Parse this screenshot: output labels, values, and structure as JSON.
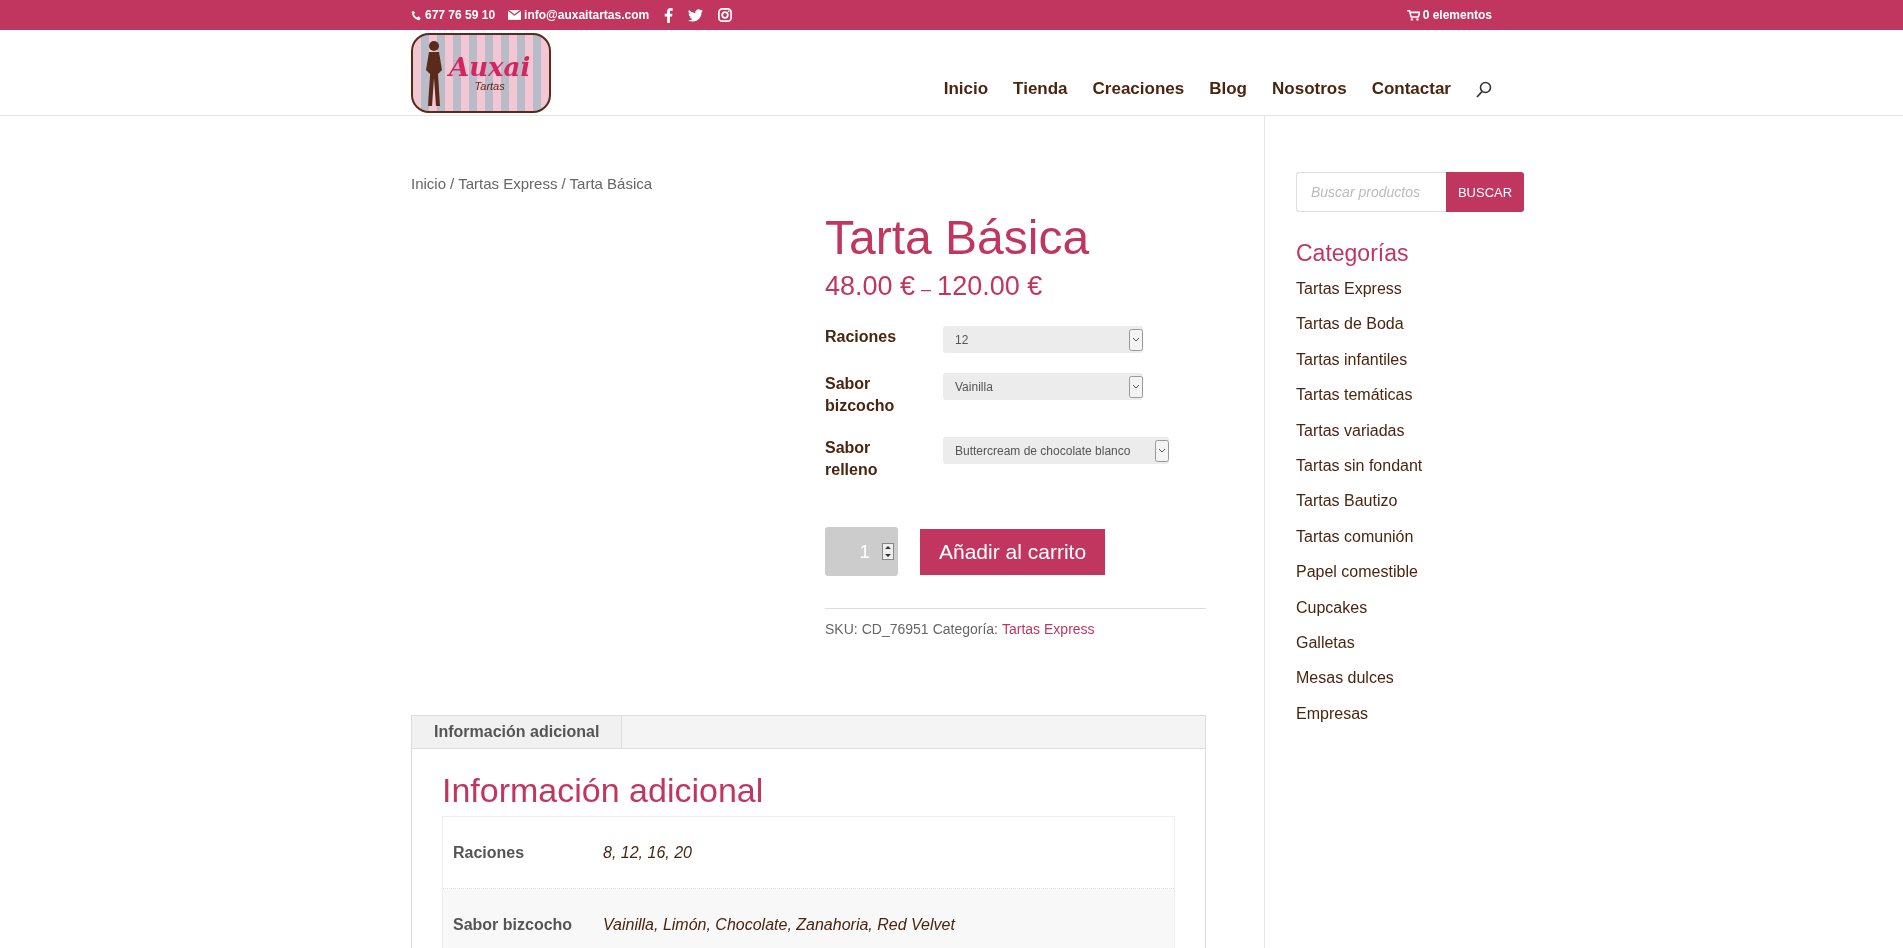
{
  "top_bar": {
    "phone": "677 76 59 10",
    "email": "info@auxaitartas.com",
    "cart": "0 elementos"
  },
  "logo": {
    "name": "Auxai",
    "tagline": "Tartas"
  },
  "nav": {
    "items": [
      {
        "label": "Inicio"
      },
      {
        "label": "Tienda"
      },
      {
        "label": "Creaciones"
      },
      {
        "label": "Blog"
      },
      {
        "label": "Nosotros"
      },
      {
        "label": "Contactar"
      }
    ]
  },
  "breadcrumb": {
    "separator": "/",
    "items": [
      "Inicio",
      "Tartas Express",
      "Tarta Básica"
    ]
  },
  "product": {
    "title": "Tarta Básica",
    "price_from": "48.00 €",
    "price_sep": "–",
    "price_to": "120.00 €",
    "options": [
      {
        "label": "Raciones",
        "value": "12"
      },
      {
        "label": "Sabor bizcocho",
        "value": "Vainilla"
      },
      {
        "label": "Sabor relleno",
        "value": "Buttercream de chocolate blanco"
      }
    ],
    "quantity": "1",
    "add_button": "Añadir al carrito",
    "meta": {
      "sku_label": "SKU:",
      "sku": "CD_76951",
      "category_label": "Categoría:",
      "category": "Tartas Express"
    }
  },
  "tabs": [
    {
      "label": "Información adicional",
      "selected": true
    }
  ],
  "info": {
    "heading": "Información adicional",
    "rows": [
      {
        "name": "Raciones",
        "value": "8, 12, 16, 20"
      },
      {
        "name": "Sabor bizcocho",
        "value": "Vainilla, Limón, Chocolate, Zanahoria, Red Velvet"
      }
    ]
  },
  "sidebar": {
    "search": {
      "placeholder": "Buscar productos",
      "button": "BUSCAR"
    },
    "heading": "Categorías",
    "items": [
      {
        "label": "Tartas Express"
      },
      {
        "label": "Tartas de Boda"
      },
      {
        "label": "Tartas infantiles"
      },
      {
        "label": "Tartas temáticas"
      },
      {
        "label": "Tartas variadas"
      },
      {
        "label": "Tartas sin fondant"
      },
      {
        "label": "Tartas Bautizo"
      },
      {
        "label": "Tartas comunión"
      },
      {
        "label": "Papel comestible"
      },
      {
        "label": "Cupcakes"
      },
      {
        "label": "Galletas"
      },
      {
        "label": "Mesas dulces"
      },
      {
        "label": "Empresas"
      }
    ]
  }
}
